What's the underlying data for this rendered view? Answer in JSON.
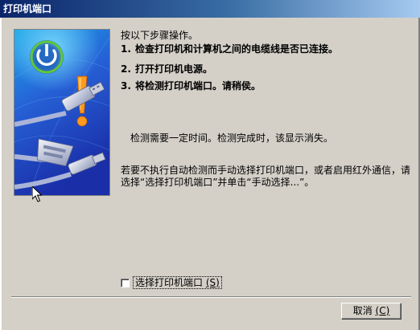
{
  "window": {
    "title": "打印机端口"
  },
  "instructions": {
    "intro": "按以下步骤操作。",
    "steps": [
      {
        "number": "1.",
        "text": "检查打印机和计算机之间的电缆线是否已连接。"
      },
      {
        "number": "2.",
        "text": "打开打印机电源。"
      },
      {
        "number": "3.",
        "text": "将检测打印机端口。请稍侯。"
      }
    ],
    "note": "检测需要一定时间。检测完成时，该显示消失。",
    "manual_hint": "若要不执行自动检测而手动选择打印机端口，或者启用红外通信，请选择“选择打印机端口”并单击“手动选择...”。"
  },
  "select_port": {
    "label": "选择打印机端口",
    "mnemonic": "(S)",
    "checked": false
  },
  "buttons": {
    "cancel_label": "取消",
    "cancel_mnemonic": "(C)"
  },
  "illustration": {
    "icons": [
      "power-icon",
      "warning-exclamation-icon",
      "usb-cable-icon",
      "parallel-connector-icon"
    ]
  },
  "colors": {
    "titlebar_start": "#0a246a",
    "titlebar_end": "#a6caf0",
    "dialog_bg": "#d4d0c8",
    "power_green": "#5fc93a",
    "warning_orange": "#ff9a1f"
  }
}
